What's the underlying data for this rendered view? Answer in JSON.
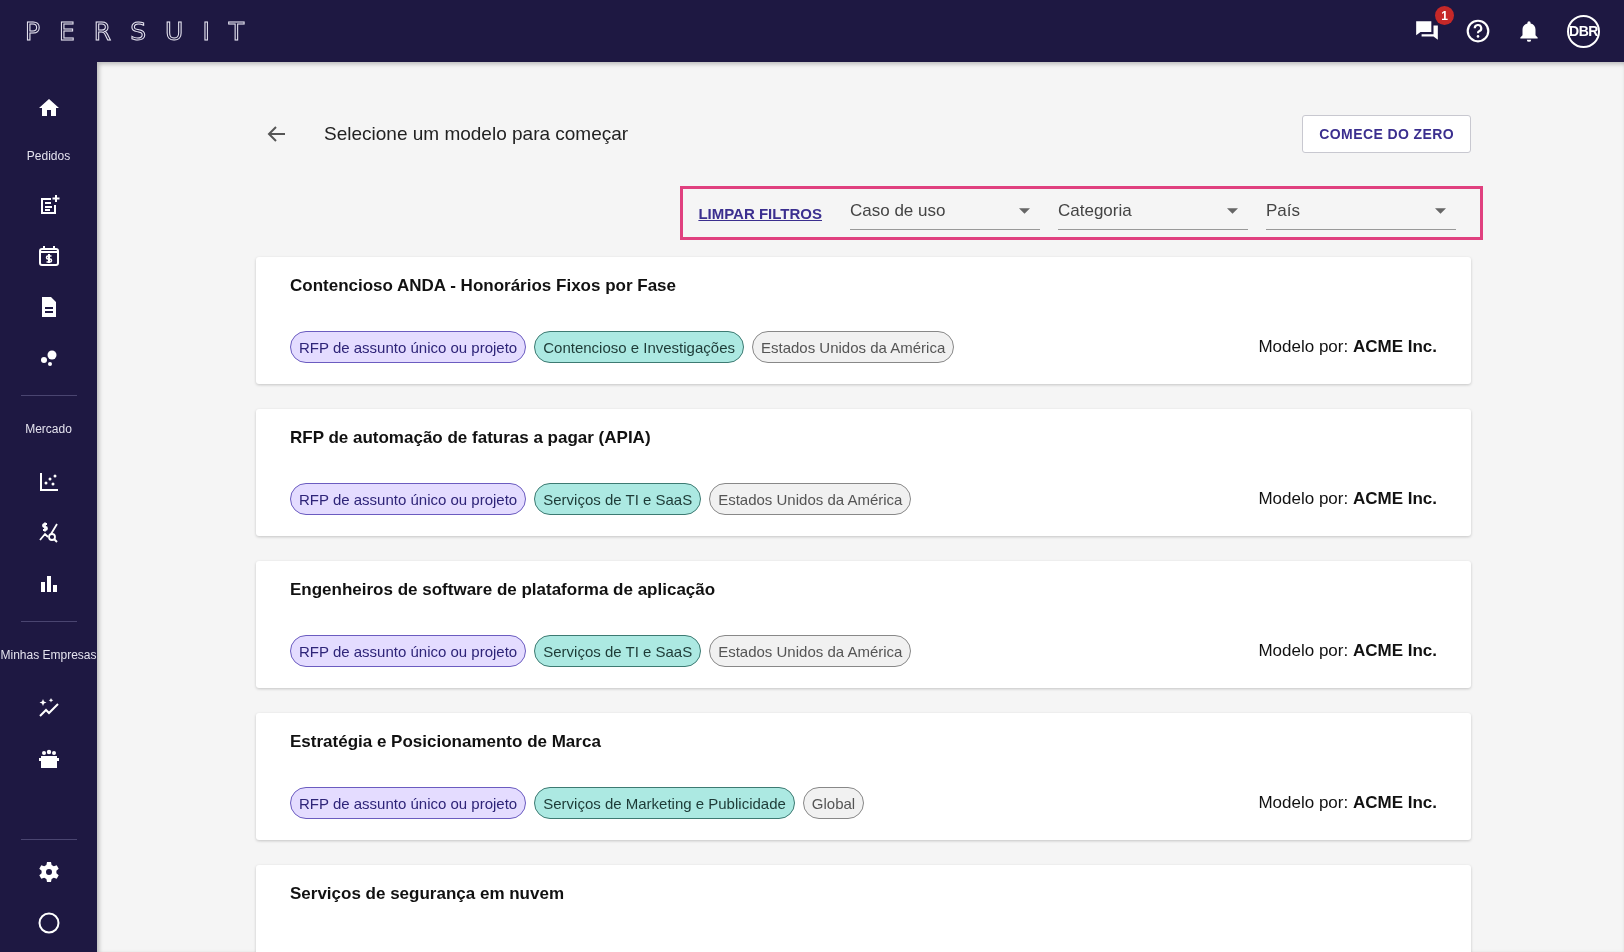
{
  "top_bar": {
    "logo": "PERSUIT",
    "messages_badge": "1",
    "avatar": "DBR"
  },
  "sidebar": {
    "sections": [
      {
        "label": "Pedidos"
      },
      {
        "label": "Mercado"
      },
      {
        "label": "Minhas Empresas"
      }
    ]
  },
  "header": {
    "title": "Selecione um modelo para começar",
    "button": "COMECE DO ZERO"
  },
  "filters": {
    "clear": "LIMPAR FILTROS",
    "dropdowns": [
      {
        "placeholder": "Caso de uso"
      },
      {
        "placeholder": "Categoria"
      },
      {
        "placeholder": "País"
      }
    ]
  },
  "templates": [
    {
      "title": "Contencioso ANDA - Honorários Fixos por Fase",
      "tags": [
        {
          "label": "RFP de assunto único ou projeto",
          "kind": "type"
        },
        {
          "label": "Contencioso e Investigações",
          "kind": "category"
        },
        {
          "label": "Estados Unidos da América",
          "kind": "region"
        }
      ],
      "author_label": "Modelo por:",
      "author": "ACME Inc."
    },
    {
      "title": "RFP de automação de faturas a pagar (APIA)",
      "tags": [
        {
          "label": "RFP de assunto único ou projeto",
          "kind": "type"
        },
        {
          "label": "Serviços de TI e SaaS",
          "kind": "category"
        },
        {
          "label": "Estados Unidos da América",
          "kind": "region"
        }
      ],
      "author_label": "Modelo por:",
      "author": "ACME Inc."
    },
    {
      "title": "Engenheiros de software de plataforma de aplicação",
      "tags": [
        {
          "label": "RFP de assunto único ou projeto",
          "kind": "type"
        },
        {
          "label": "Serviços de TI e SaaS",
          "kind": "category"
        },
        {
          "label": "Estados Unidos da América",
          "kind": "region"
        }
      ],
      "author_label": "Modelo por:",
      "author": "ACME Inc."
    },
    {
      "title": "Estratégia e Posicionamento de Marca",
      "tags": [
        {
          "label": "RFP de assunto único ou projeto",
          "kind": "type"
        },
        {
          "label": "Serviços de Marketing e Publicidade",
          "kind": "category"
        },
        {
          "label": "Global",
          "kind": "region"
        }
      ],
      "author_label": "Modelo por:",
      "author": "ACME Inc."
    },
    {
      "title": "Serviços de segurança em nuvem"
    }
  ]
}
